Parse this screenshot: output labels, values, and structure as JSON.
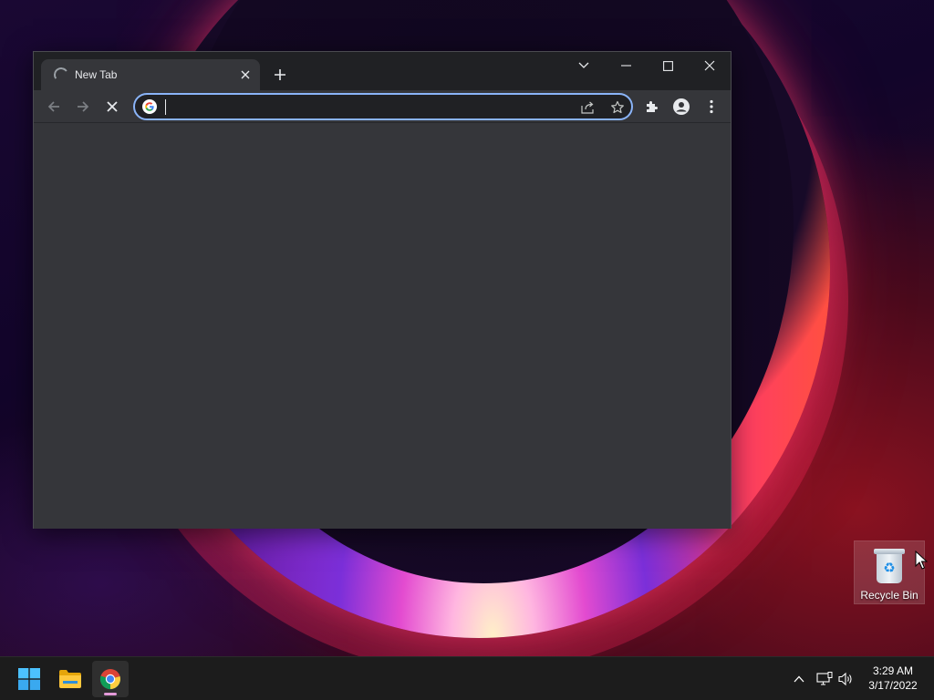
{
  "desktop": {
    "icons": [
      {
        "label": "Recycle Bin",
        "icon": "recycle-bin-icon"
      }
    ]
  },
  "browser": {
    "tabs": [
      {
        "title": "New Tab",
        "loading": true,
        "active": true
      }
    ],
    "new_tab_glyph": "+",
    "window_controls": [
      "tab-search",
      "minimize",
      "maximize",
      "close"
    ],
    "omnibox": {
      "value": "",
      "placeholder": "",
      "focused": true
    },
    "toolbar_buttons": [
      "back",
      "forward",
      "stop",
      "share",
      "bookmark",
      "extensions",
      "profile",
      "menu"
    ],
    "theme": {
      "frame": "#202124",
      "toolbar": "#35363a",
      "focus_ring": "#8ab4f8"
    }
  },
  "taskbar": {
    "apps": [
      {
        "name": "start-button",
        "icon": "windows-logo-icon"
      },
      {
        "name": "file-explorer",
        "icon": "folder-icon"
      },
      {
        "name": "google-chrome",
        "icon": "chrome-icon",
        "running": true,
        "active": true
      }
    ],
    "tray": [
      "chevron-up-icon",
      "network-icon",
      "volume-icon"
    ],
    "clock": {
      "time": "3:29 AM",
      "date": "3/17/2022"
    }
  }
}
